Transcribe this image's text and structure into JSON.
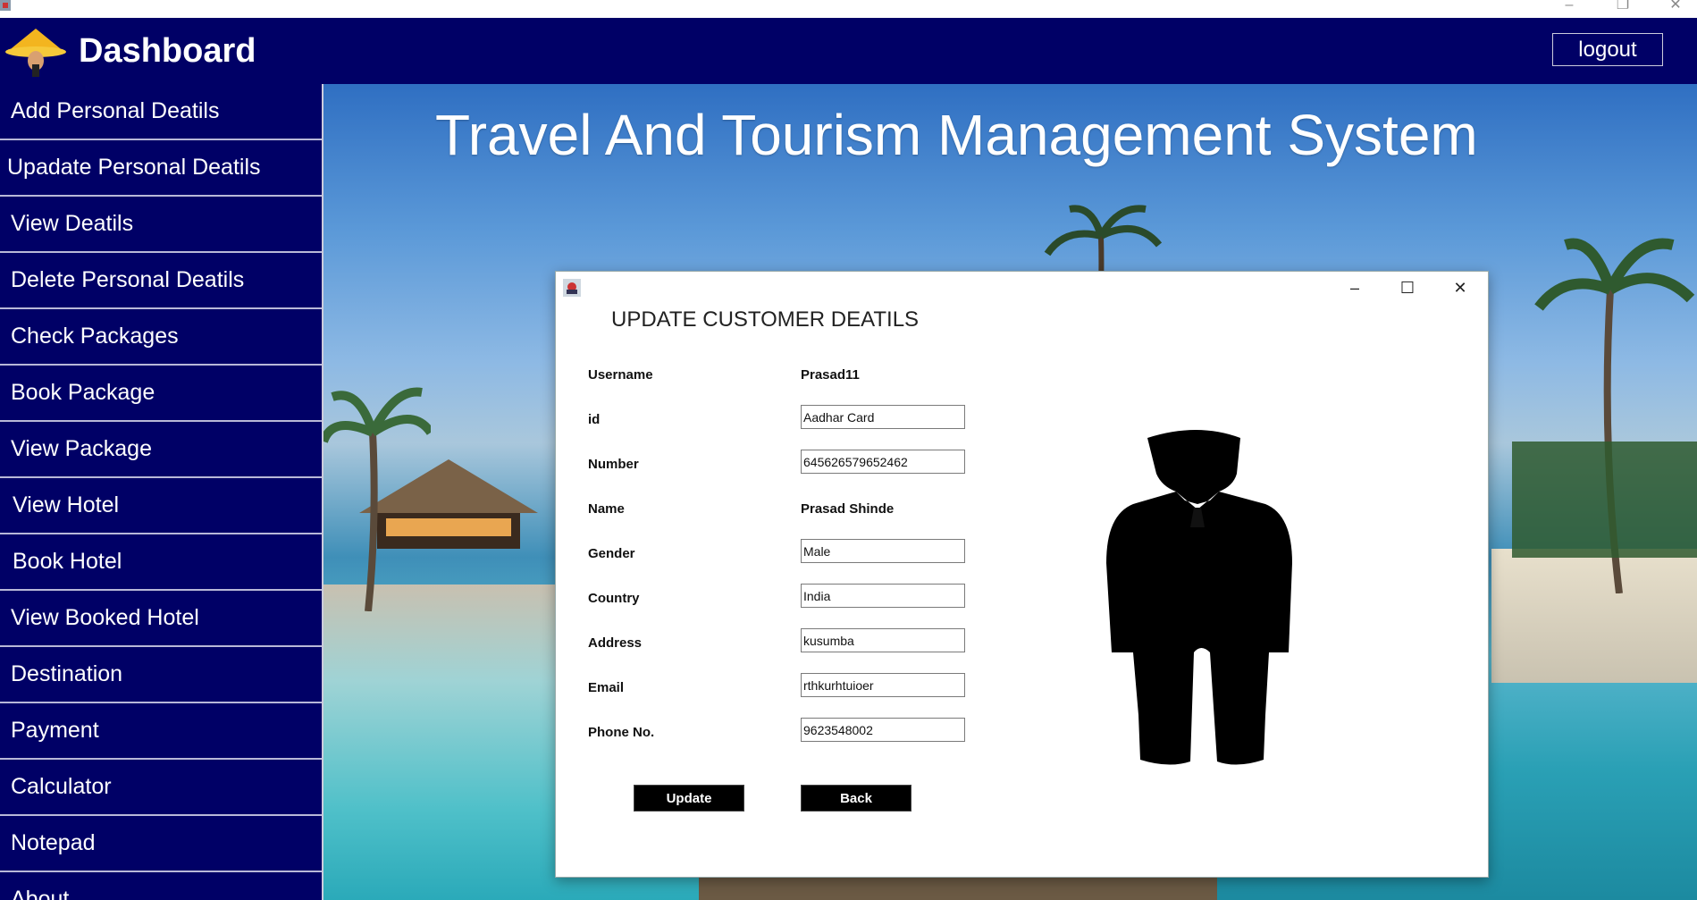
{
  "app": {
    "header_title": "Dashboard",
    "logout_label": "logout",
    "main_title": "Travel And Tourism Management System"
  },
  "sidebar": {
    "items": [
      {
        "label": "Add Personal Deatils"
      },
      {
        "label": "Upadate Personal Deatils"
      },
      {
        "label": "View Deatils"
      },
      {
        "label": "Delete Personal Deatils"
      },
      {
        "label": "Check Packages"
      },
      {
        "label": "Book Package"
      },
      {
        "label": "View Package"
      },
      {
        "label": "View Hotel"
      },
      {
        "label": "Book Hotel"
      },
      {
        "label": "View Booked Hotel"
      },
      {
        "label": "Destination"
      },
      {
        "label": "Payment"
      },
      {
        "label": "Calculator"
      },
      {
        "label": "Notepad"
      },
      {
        "label": "About"
      }
    ]
  },
  "dialog": {
    "heading": "UPDATE CUSTOMER DEATILS",
    "labels": {
      "username": "Username",
      "id": "id",
      "number": "Number",
      "name": "Name",
      "gender": "Gender",
      "country": "Country",
      "address": "Address",
      "email": "Email",
      "phone": "Phone No."
    },
    "values": {
      "username": "Prasad11",
      "id": "Aadhar Card",
      "number": "645626579652462",
      "name": "Prasad Shinde",
      "gender": "Male",
      "country": "India",
      "address": "kusumba",
      "email": "rthkurhtuioer",
      "phone": "9623548002"
    },
    "update_label": "Update",
    "back_label": "Back"
  },
  "colors": {
    "header_bg": "#000066",
    "sidebar_bg": "#000066",
    "button_bg": "#000000"
  },
  "icons": {
    "logo": "hat-logo-icon",
    "dialog": "java-app-icon",
    "silhouette": "person-silhouette-icon"
  }
}
